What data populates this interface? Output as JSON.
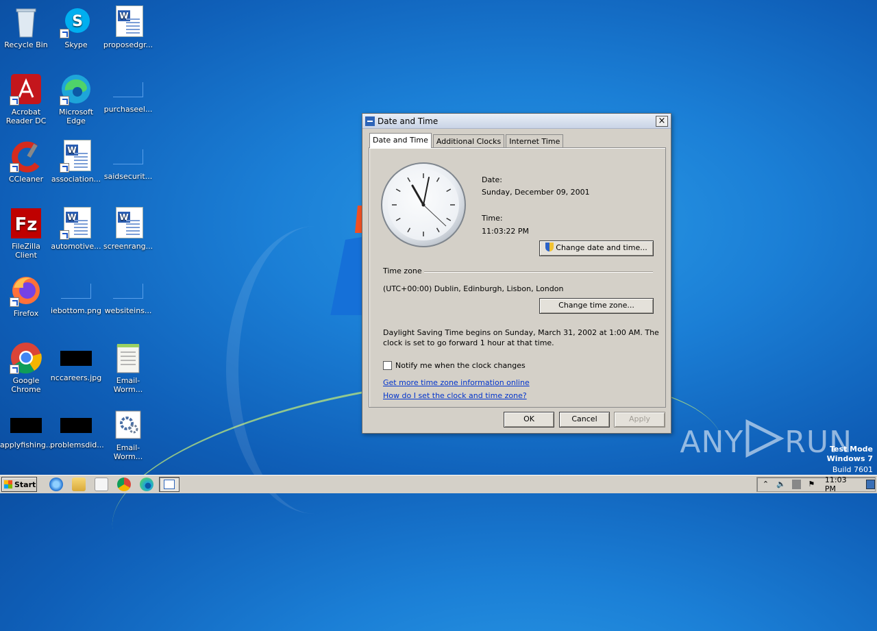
{
  "desktop": {
    "icons": [
      {
        "label": "Recycle Bin"
      },
      {
        "label": "Skype"
      },
      {
        "label": "proposedgr..."
      },
      {
        "label": "Acrobat Reader DC"
      },
      {
        "label": "Microsoft Edge"
      },
      {
        "label": "purchaseel..."
      },
      {
        "label": "CCleaner"
      },
      {
        "label": "association..."
      },
      {
        "label": "saidsecurit..."
      },
      {
        "label": "FileZilla Client"
      },
      {
        "label": "automotive..."
      },
      {
        "label": "screenrang..."
      },
      {
        "label": "Firefox"
      },
      {
        "label": "iebottom.png"
      },
      {
        "label": "websiteins..."
      },
      {
        "label": "Google Chrome"
      },
      {
        "label": "nccareers.jpg"
      },
      {
        "label": "Email-Worm..."
      },
      {
        "label": "applyfishing..."
      },
      {
        "label": "problemsdid..."
      },
      {
        "label": "Email-Worm..."
      }
    ]
  },
  "dialog": {
    "title": "Date and Time",
    "close_label": "×",
    "tabs": [
      {
        "label": "Date and Time"
      },
      {
        "label": "Additional Clocks"
      },
      {
        "label": "Internet Time"
      }
    ],
    "date_label": "Date:",
    "date_value": "Sunday, December 09, 2001",
    "time_label": "Time:",
    "time_value": "11:03:22 PM",
    "change_datetime_button": "Change date and time...",
    "timezone_group": "Time zone",
    "timezone_value": "(UTC+00:00) Dublin, Edinburgh, Lisbon, London",
    "change_timezone_button": "Change time zone...",
    "dst_line1": "Daylight Saving Time begins on Sunday, March 31, 2002 at 1:00 AM. The",
    "dst_line2": "clock is set to go forward 1 hour at that time.",
    "notify_label": "Notify me when the clock changes",
    "notify_checked": false,
    "link_more_info": "Get more time zone information online",
    "link_how_to": "How do I set the clock and time zone?",
    "ok_button": "OK",
    "cancel_button": "Cancel",
    "apply_button": "Apply"
  },
  "taskbar": {
    "start_label": "Start",
    "clock": "11:03 PM"
  },
  "watermark": {
    "brand_left": "ANY",
    "brand_right": "RUN",
    "line1": "Test Mode",
    "line2": "Windows 7",
    "line3": "Build 7601"
  },
  "colors": {
    "desktop_blue": "#1b7fd6",
    "dialog_bg": "#d4d0c8",
    "link": "#0033cc"
  }
}
